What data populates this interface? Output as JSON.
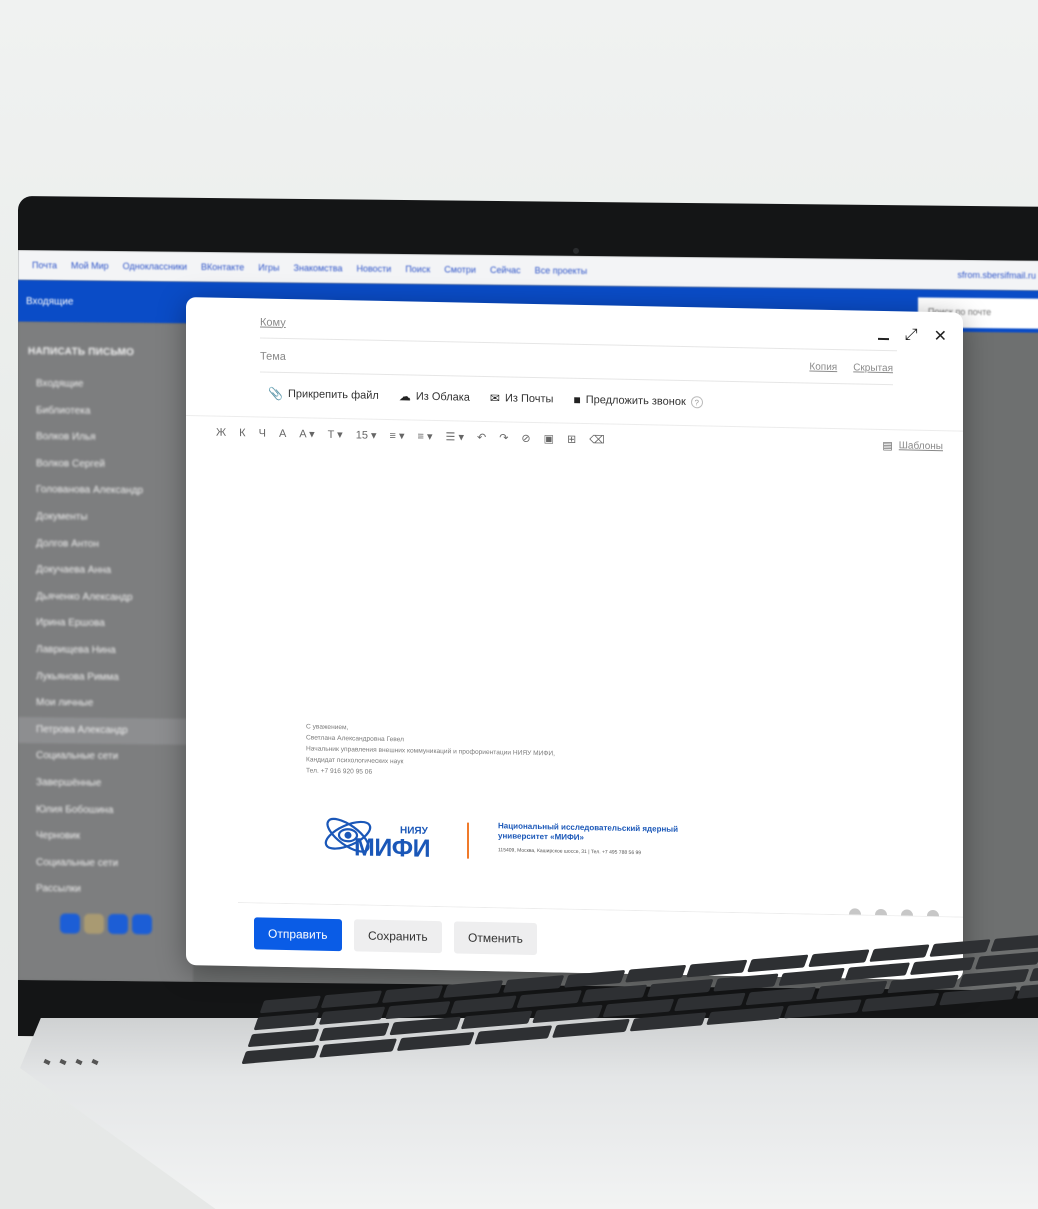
{
  "mail_nav": {
    "links": [
      "Почта",
      "Мой Мир",
      "Одноклассники",
      "ВКонтакте",
      "Игры",
      "Знакомства",
      "Новости",
      "Поиск",
      "Смотри",
      "Сейчас",
      "Все проекты"
    ],
    "user_email": "sfrom.sbersifmail.ru"
  },
  "mail_header": {
    "folders_label": "Входящие",
    "search_placeholder": "Поиск по почте"
  },
  "sidebar": {
    "compose_label": "НАПИСАТЬ ПИСЬМО",
    "items": [
      "Входящие",
      "Библиотека",
      "Волков Илья",
      "Волков Сергей",
      "Голованова Александр",
      "Документы",
      "Долгов Антон",
      "Докучаева Анна",
      "Дьяченко Александр",
      "Ирина Ершова",
      "Лаврищева Нина",
      "Лукьянова Римма",
      "Мои личные",
      "Петрова Александр",
      "Социальные сети",
      "Завершённые",
      "Юлия Бобошина",
      "Черновик",
      "Социальные сети",
      "Рассылки"
    ],
    "active_index": 13
  },
  "compose": {
    "to_label": "Кому",
    "subject_label": "Тема",
    "cc_label": "Копия",
    "bcc_label": "Скрытая",
    "attach_file": "Прикрепить файл",
    "from_cloud": "Из Облака",
    "from_mail": "Из Почты",
    "suggest_call": "Предложить звонок",
    "format_buttons": [
      "Ж",
      "К",
      "Ч",
      "A",
      "A ▾",
      "T ▾",
      "15 ▾",
      "≡ ▾",
      "≡ ▾",
      "☰ ▾",
      "↶",
      "↷",
      "⊘",
      "▣",
      "⊞",
      "⌫"
    ],
    "templates_label": "Шаблоны",
    "signature_lines": [
      "С уважением,",
      "Светлана Александровна Гевел",
      "Начальник управления внешних коммуникаций и профориентации НИЯУ МИФИ,",
      "Кандидат психологических наук",
      "Тел. +7 916 920 95 06"
    ],
    "logo_small": "НИЯУ",
    "logo_word": "МИФИ",
    "university_name": "Национальный исследовательский ядерный университет «МИФИ»",
    "university_address": "115409, Москва, Каширское шоссе, 31  |  Тел. +7 495 788 56 99",
    "send_label": "Отправить",
    "save_label": "Сохранить",
    "cancel_label": "Отменить"
  },
  "colors": {
    "accent": "#0a5ce6",
    "mail_bar": "#0a4cc7",
    "logo_blue": "#1a57b8",
    "logo_orange": "#f07a2a"
  }
}
